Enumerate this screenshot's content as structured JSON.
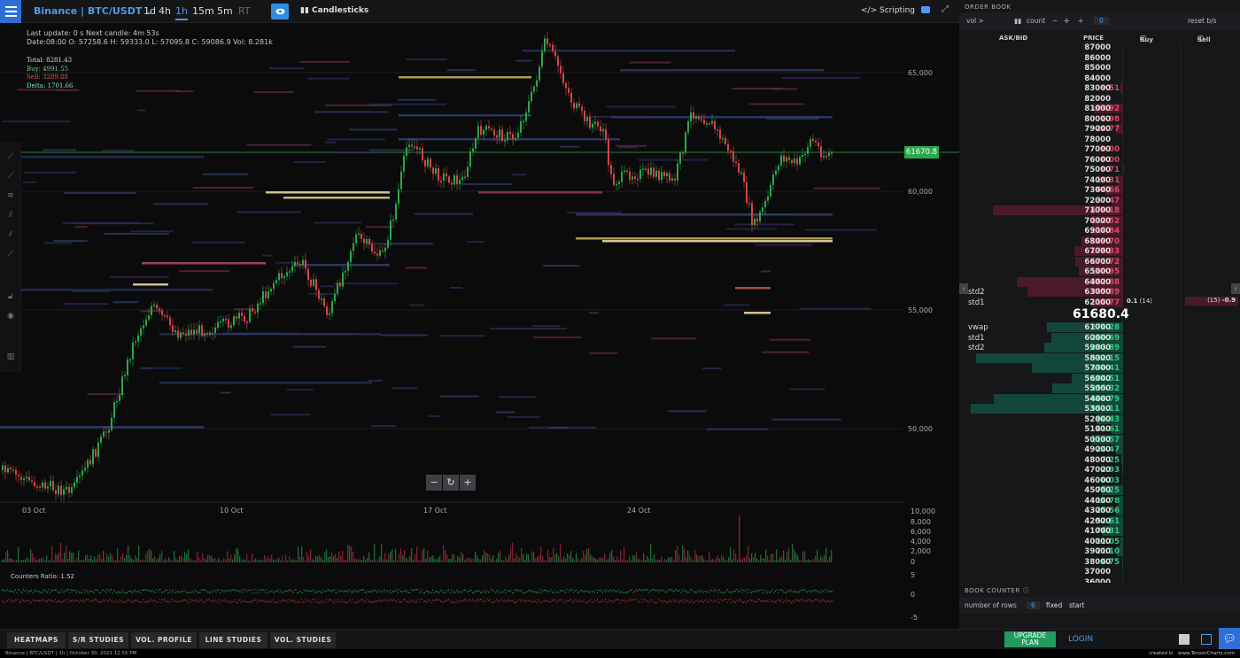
{
  "topbar": {
    "market": "Binance | BTC/USDT",
    "timeframes": [
      "1d",
      "4h",
      "1h",
      "15m",
      "5m",
      "RT"
    ],
    "active_timeframe": "1h",
    "candles_label": "Candlesticks",
    "scripting_label": "</> Scripting",
    "icons": [
      "menu-icon",
      "chevron-down-icon",
      "eye-icon",
      "bar-chart-icon",
      "camera-icon",
      "expand-icon"
    ]
  },
  "info": {
    "line1": "Last update: 0    s    Next candle: 4m 53s",
    "line2": "Date:08:00 O: 57258.6 H: 59333.0 L: 57095.8 C: 59086.9 Vol: 8.281k"
  },
  "counters": {
    "total": "Total: 8281.43",
    "buy": "Buy: 4991.55",
    "sell": "Sell: 3289.88",
    "delta": "Delta: 1701.66"
  },
  "price_axis": [
    "65,000",
    "60,000",
    "55,000",
    "50,000"
  ],
  "current_price_tag": "61670.8",
  "dates": [
    "03 Oct",
    "10 Oct",
    "17 Oct",
    "24 Oct"
  ],
  "volume_axis": [
    "10,000",
    "8,000",
    "6,000",
    "4,000",
    "2,000",
    "0"
  ],
  "ratio_axis": [
    "5",
    "0",
    "-5"
  ],
  "counters_ratio": "Counters Ratio: 1.52",
  "zoom": {
    "minus": "−",
    "reset": "↻",
    "plus": "+"
  },
  "bottom_tabs": [
    "HEATMAPS",
    "S/R STUDIES",
    "VOL. PROFILE",
    "LINE STUDIES",
    "VOL. STUDIES"
  ],
  "upgrade_line1": "UPGRADE",
  "upgrade_line2": "PLAN",
  "login": "LOGIN",
  "status_left": "Binance | BTC/USDT | 1h | October 30, 2021 12:55 PM",
  "status_right_created": "created in",
  "status_right_site": "www.TensorCharts.com",
  "orderbook": {
    "title": "ORDER BOOK",
    "vol_label": "vol >",
    "count_label": "count",
    "zero_value": "0",
    "reset_label": "reset b/s",
    "headers": {
      "askbid": "ASK/BID",
      "price": "PRICE",
      "buy": "Buy",
      "sell": "Sell"
    },
    "asks": [
      {
        "price": "87000",
        "amt": ""
      },
      {
        "price": "86000",
        "amt": ""
      },
      {
        "price": "85000",
        "amt": ""
      },
      {
        "price": "84000",
        "amt": ""
      },
      {
        "price": "83000",
        "amt": "9.51"
      },
      {
        "price": "82000",
        "amt": ""
      },
      {
        "price": "81000",
        "amt": "103.92"
      },
      {
        "price": "80000",
        "amt": "4.98"
      },
      {
        "price": "79000",
        "amt": "24.77"
      },
      {
        "price": "78000",
        "amt": ""
      },
      {
        "price": "77000",
        "amt": "0.00"
      },
      {
        "price": "76000",
        "amt": "0.00"
      },
      {
        "price": "75000",
        "amt": "0.71"
      },
      {
        "price": "74000",
        "amt": "18.31"
      },
      {
        "price": "73000",
        "amt": "64.66"
      },
      {
        "price": "72000",
        "amt": "37.47"
      },
      {
        "price": "71000",
        "amt": "470.18"
      },
      {
        "price": "70000",
        "amt": "112.52"
      },
      {
        "price": "69000",
        "amt": "114.84"
      },
      {
        "price": "68000",
        "amt": "149.70"
      },
      {
        "price": "67000",
        "amt": "176.33"
      },
      {
        "price": "66000",
        "amt": "171.72"
      },
      {
        "price": "65000",
        "amt": "160.95"
      },
      {
        "price": "64000",
        "amt": "382.88"
      },
      {
        "price": "63000",
        "amt": "345.89",
        "label": "std2"
      },
      {
        "price": "62000",
        "amt": "114.77",
        "label": "std1"
      }
    ],
    "mid_price": "61680.4",
    "buy_counter": "0.1",
    "buy_counter_n": "(14)",
    "sell_counter_n": "(15)",
    "sell_counter": "-0.9",
    "bids": [
      {
        "price": "61000",
        "amt": "274.28",
        "label": "vwap"
      },
      {
        "price": "60000",
        "amt": "260.69",
        "label": "std1"
      },
      {
        "price": "59000",
        "amt": "283.89",
        "label": "std2"
      },
      {
        "price": "58000",
        "amt": "532.15"
      },
      {
        "price": "57000",
        "amt": "330.41"
      },
      {
        "price": "56000",
        "amt": "184.51"
      },
      {
        "price": "55000",
        "amt": "255.32"
      },
      {
        "price": "54000",
        "amt": "468.79"
      },
      {
        "price": "53000",
        "amt": "551.11"
      },
      {
        "price": "52000",
        "amt": "94.43"
      },
      {
        "price": "51000",
        "amt": "41.61"
      },
      {
        "price": "50000",
        "amt": "113.57"
      },
      {
        "price": "49000",
        "amt": "24.47"
      },
      {
        "price": "48000",
        "amt": "7.25"
      },
      {
        "price": "47000",
        "amt": "2.93"
      },
      {
        "price": "46000",
        "amt": "0.03"
      },
      {
        "price": "45000",
        "amt": "75.25"
      },
      {
        "price": "44000",
        "amt": "14.78"
      },
      {
        "price": "43000",
        "amt": "25.56"
      },
      {
        "price": "42000",
        "amt": "52.61"
      },
      {
        "price": "41000",
        "amt": "74.31"
      },
      {
        "price": "40000",
        "amt": "11.05"
      },
      {
        "price": "39000",
        "amt": "21.10"
      },
      {
        "price": "38000",
        "amt": "4.75"
      },
      {
        "price": "37000",
        "amt": ""
      },
      {
        "price": "36000",
        "amt": ""
      }
    ],
    "book_counter_title": "BOOK COUNTER",
    "rows_label": "number of rows",
    "rows_value": "6",
    "fixed_label": "fixed",
    "start_label": "start"
  },
  "colors": {
    "accent": "#2d6fd6",
    "bid": "#2ad07f",
    "ask": "#e04a6a",
    "up": "#2aa84a",
    "down": "#d64545"
  }
}
